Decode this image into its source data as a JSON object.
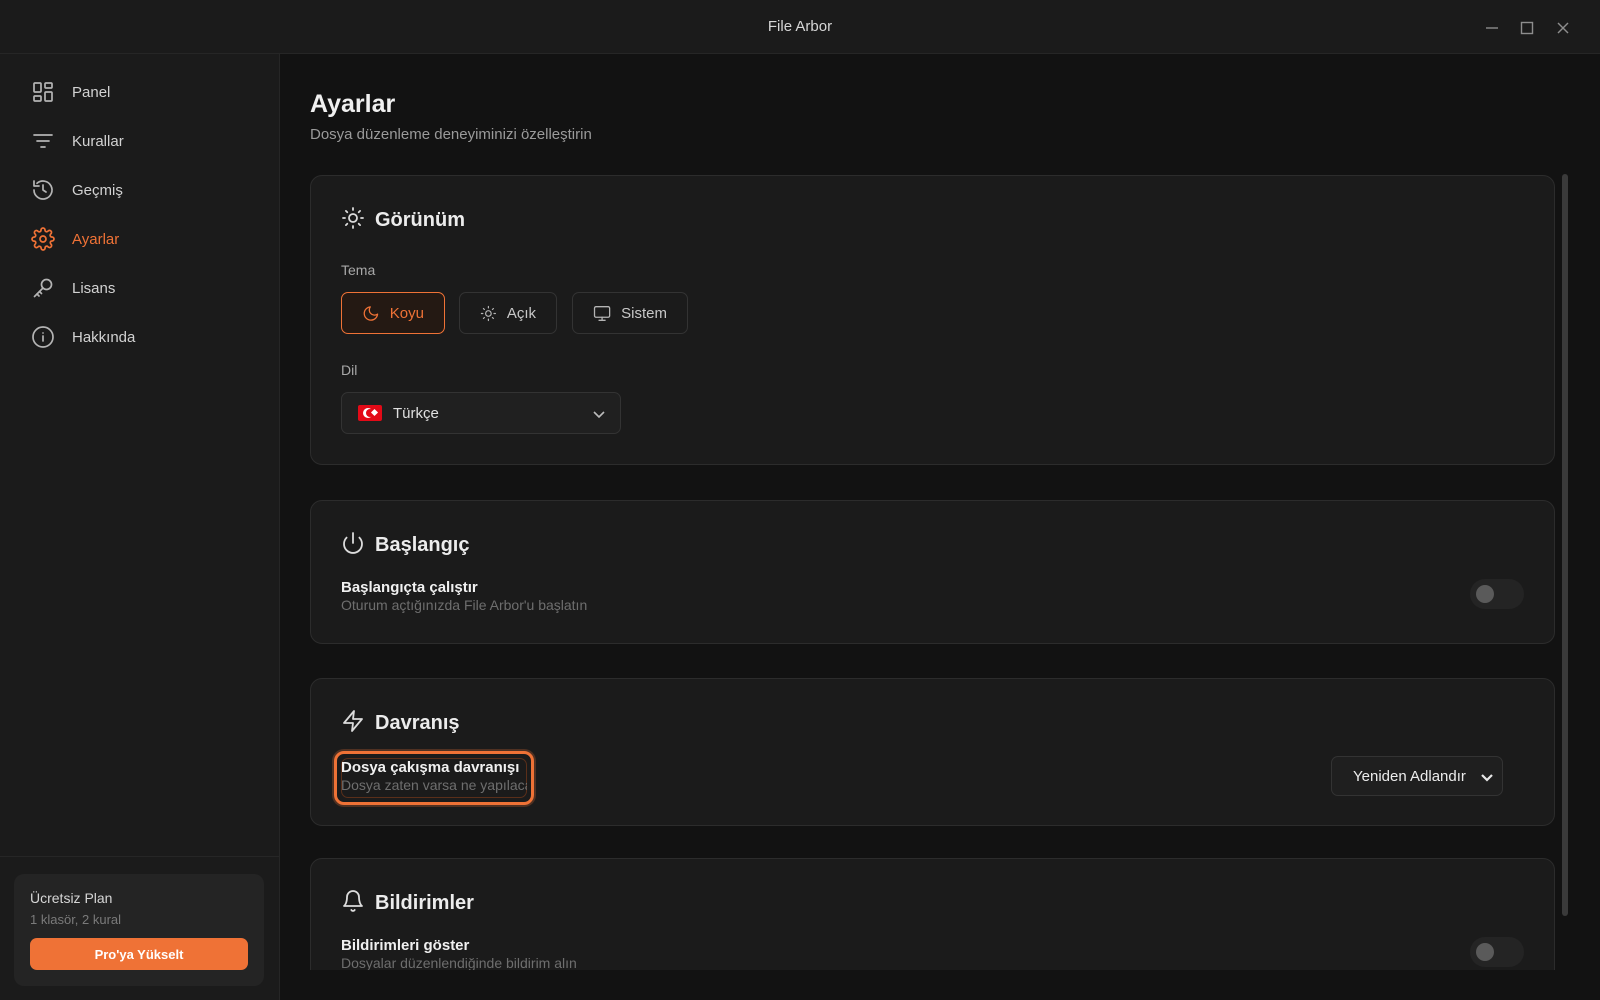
{
  "window": {
    "title": "File Arbor",
    "controls": [
      "minimize-icon",
      "maximize-icon",
      "close-icon"
    ]
  },
  "sidebar": {
    "items": [
      {
        "label": "Panel",
        "icon": "dashboard-grid-icon",
        "active": false
      },
      {
        "label": "Kurallar",
        "icon": "filter-lines-icon",
        "active": false
      },
      {
        "label": "Geçmiş",
        "icon": "history-icon",
        "active": false
      },
      {
        "label": "Ayarlar",
        "icon": "gear-icon",
        "active": true
      },
      {
        "label": "Lisans",
        "icon": "key-icon",
        "active": false
      },
      {
        "label": "Hakkında",
        "icon": "info-icon",
        "active": false
      }
    ],
    "plan": {
      "title": "Ücretsiz Plan",
      "subtitle": "1 klasör, 2 kural",
      "upgrade_label": "Pro'ya Yükselt"
    }
  },
  "main": {
    "title": "Ayarlar",
    "subtitle": "Dosya düzenleme deneyiminizi özelleştirin",
    "appearance": {
      "title": "Görünüm",
      "icon": "sun-icon",
      "theme_label": "Tema",
      "themes": [
        {
          "label": "Koyu",
          "icon": "moon-icon",
          "selected": true
        },
        {
          "label": "Açık",
          "icon": "sun-icon",
          "selected": false
        },
        {
          "label": "Sistem",
          "icon": "monitor-icon",
          "selected": false
        }
      ],
      "language_label": "Dil",
      "language_value": "Türkçe",
      "language_flag": "turkey-flag-icon"
    },
    "startup": {
      "title": "Başlangıç",
      "icon": "power-icon",
      "run_title": "Başlangıçta çalıştır",
      "run_desc": "Oturum açtığınızda File Arbor'u başlatın",
      "run_enabled": false
    },
    "behavior": {
      "title": "Davranış",
      "icon": "lightning-icon",
      "conflict_title": "Dosya çakışma davranışı",
      "conflict_desc": "Dosya zaten varsa ne yapılacağı",
      "conflict_value": "Yeniden Adlandır"
    },
    "notifications": {
      "title": "Bildirimler",
      "icon": "bell-icon",
      "show_title": "Bildirimleri göster",
      "show_desc": "Dosyalar düzenlendiğinde bildirim alın",
      "show_enabled": false
    }
  },
  "colors": {
    "accent": "#ef7236",
    "background": "#121212",
    "surface": "#1b1b1b"
  }
}
